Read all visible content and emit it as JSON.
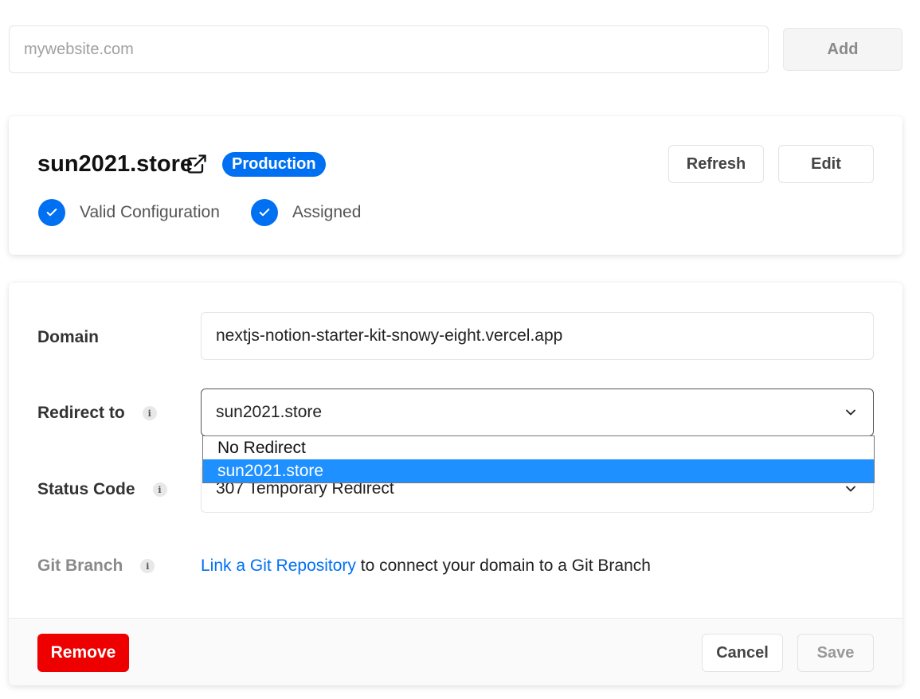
{
  "add_domain": {
    "placeholder": "mywebsite.com",
    "value": "",
    "add_label": "Add"
  },
  "domain_card": {
    "title": "sun2021.store",
    "badge": "Production",
    "refresh_label": "Refresh",
    "edit_label": "Edit",
    "checks": [
      {
        "label": "Valid Configuration",
        "icon": "check-icon"
      },
      {
        "label": "Assigned",
        "icon": "check-icon"
      }
    ],
    "accent_color": "#0070f3"
  },
  "settings": {
    "domain_label": "Domain",
    "domain_value": "nextjs-notion-starter-kit-snowy-eight.vercel.app",
    "redirect_label": "Redirect to",
    "redirect_value": "sun2021.store",
    "redirect_options": [
      "No Redirect",
      "sun2021.store"
    ],
    "redirect_selected_index": 1,
    "status_label": "Status Code",
    "status_value": "307 Temporary Redirect",
    "git_label": "Git Branch",
    "git_link": "Link a Git Repository",
    "git_text": " to connect your domain to a Git Branch"
  },
  "footer": {
    "remove_label": "Remove",
    "cancel_label": "Cancel",
    "save_label": "Save",
    "danger_color": "#ee0000"
  }
}
